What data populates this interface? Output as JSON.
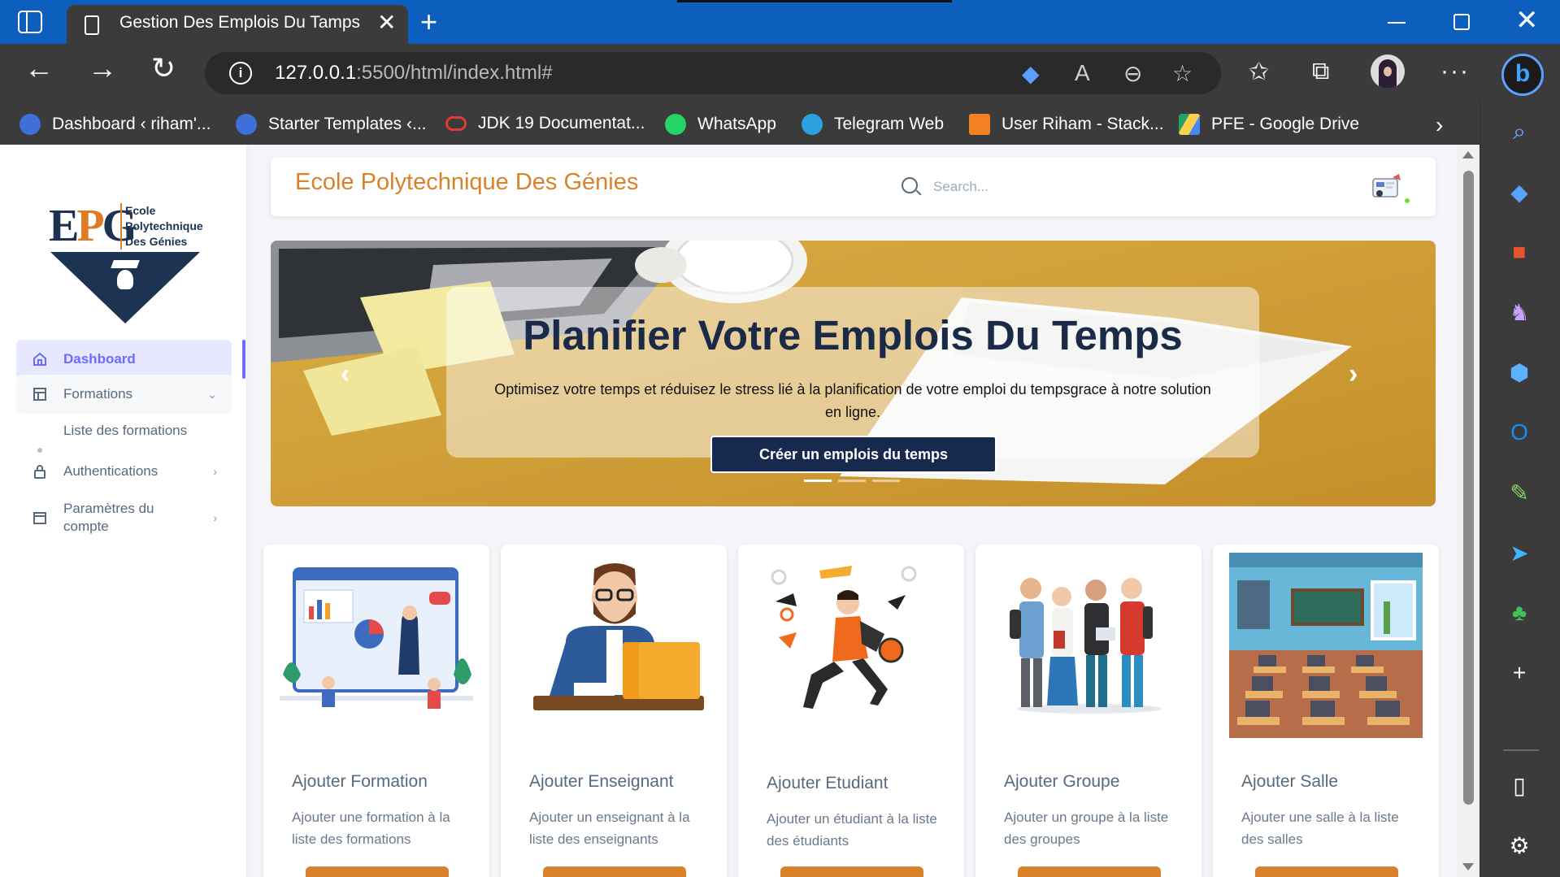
{
  "browser": {
    "tab_title": "Gestion Des Emplois Du Tamps",
    "url_host": "127.0.0.1",
    "url_rest": ":5500/html/index.html#",
    "bookmarks": [
      {
        "label": "Dashboard ‹ riham'...",
        "color": "#3f6fd8"
      },
      {
        "label": "Starter Templates ‹...",
        "color": "#3f6fd8"
      },
      {
        "label": "JDK 19 Documentat...",
        "color": "#e03c31"
      },
      {
        "label": "WhatsApp",
        "color": "#25d366"
      },
      {
        "label": "Telegram Web",
        "color": "#2aa1de"
      },
      {
        "label": "User Riham - Stack...",
        "color": "#f48024"
      },
      {
        "label": "PFE - Google Drive",
        "color": "#1fa463"
      }
    ]
  },
  "sidebar": {
    "logo_lines": [
      "Ecole",
      "Polytechnique",
      "Des Génies"
    ],
    "logo_letters": [
      "E",
      "P",
      "G"
    ],
    "items": [
      {
        "label": "Dashboard"
      },
      {
        "label": "Formations"
      },
      {
        "label": "Liste des formations"
      },
      {
        "label": "Authentications"
      },
      {
        "label": "Paramètres du compte"
      }
    ]
  },
  "navbar": {
    "brand": "Ecole Polytechnique Des Génies",
    "search_placeholder": "Search..."
  },
  "hero": {
    "title": "Planifier Votre Emplois Du Temps",
    "text": "Optimisez votre temps et réduisez le stress lié à la planification de votre emploi du tempsgrace à notre solution en ligne.",
    "button": "Créer un emplois du temps",
    "slides": 3,
    "active_slide": 1
  },
  "cards": [
    {
      "title": "Ajouter Formation",
      "text": "Ajouter une formation à la liste des formations"
    },
    {
      "title": "Ajouter Enseignant",
      "text": "Ajouter un enseignant à la liste des enseignants"
    },
    {
      "title": "Ajouter Etudiant",
      "text": "Ajouter un étudiant à la liste des étudiants"
    },
    {
      "title": "Ajouter Groupe",
      "text": "Ajouter un groupe à la liste des groupes"
    },
    {
      "title": "Ajouter Salle",
      "text": "Ajouter une salle à la liste des salles"
    }
  ],
  "colors": {
    "accent": "#696cff",
    "brand_orange": "#d9822b",
    "navy": "#172a4d"
  }
}
